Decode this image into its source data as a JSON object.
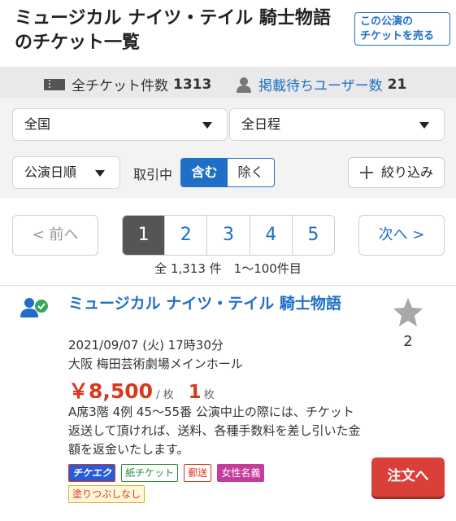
{
  "header": {
    "title": "ミュージカル ナイツ・テイル 騎士物語のチケット一覧",
    "sell_button_line1": "この公演の",
    "sell_button_line2": "チケットを売る"
  },
  "stats": {
    "tickets_label": "全チケット件数",
    "tickets_count": "1313",
    "waiting_label": "掲載待ちユーザー数",
    "waiting_count": "21"
  },
  "filters": {
    "region": "全国",
    "schedule": "全日程",
    "sort": "公演日順",
    "trade_label": "取引中",
    "include_label": "含む",
    "exclude_label": "除く",
    "refine_label": "絞り込み"
  },
  "pagination": {
    "prev_label": "< 前へ",
    "next_label": "次へ >",
    "pages": [
      "1",
      "2",
      "3",
      "4",
      "5"
    ],
    "current_page": "1",
    "summary": "全 1,313 件　1〜100件目"
  },
  "listing": {
    "title": "ミュージカル ナイツ・テイル 騎士物語",
    "date": "2021/09/07 (火) 17時30分",
    "venue": "大阪 梅田芸術劇場メインホール",
    "price": "￥8,500",
    "price_unit": "/ 枚",
    "quantity": "1",
    "quantity_unit": "枚",
    "description": "A席3階 4例 45〜55番 公演中止の際には、チケット返送して頂ければ、送料、各種手数料を差し引いた金額を返金いたします。",
    "tags": [
      "チケエク",
      "紙チケット",
      "郵送",
      "女性名義",
      "塗りつぶしなし"
    ],
    "favorite_count": "2",
    "order_label": "注文へ"
  },
  "colors": {
    "accent_blue": "#1f6fc6",
    "price_red": "#d9381e",
    "order_red": "#d9403a",
    "filter_bg": "#f3f3f3"
  },
  "icons": {
    "ticket": "ticket-icon",
    "user": "user-icon",
    "plus": "plus-icon",
    "star": "star-icon",
    "seller": "verified-seller-icon"
  }
}
